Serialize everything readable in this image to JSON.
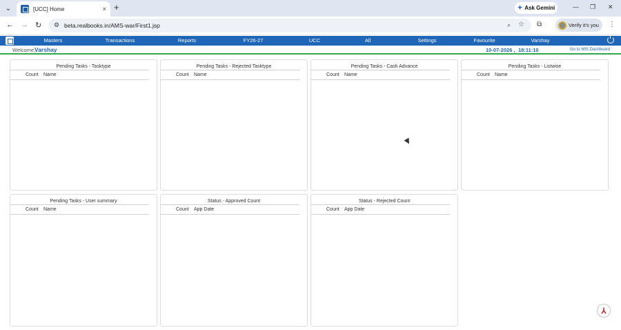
{
  "browser": {
    "tab_title": "[UCC] Home",
    "tab_close": "×",
    "new_tab": "+",
    "ask_gemini": "Ask Gemini",
    "url": "beta.realbooks.in/AMS-war/First1.jsp",
    "verify_label": "Verify it's you",
    "minimize": "—",
    "maximize": "❐",
    "close": "✕"
  },
  "nav_icons": {
    "back": "←",
    "forward": "→",
    "reload": "↻",
    "zoom": "🔍",
    "bookmark": "☆",
    "extensions": "⬚",
    "menu": "⋮",
    "tune": "⚙",
    "tab_search": "⌄"
  },
  "menu": [
    "Masters",
    "Transactions",
    "Reports",
    "FY26-27",
    "UCC",
    "All",
    "Settings",
    "Favourite",
    "Varshay"
  ],
  "welcome": {
    "label": "Welcome,",
    "user": "Varshay",
    "date": "10-07-2026 ,",
    "time": "18:11:10",
    "mis_link": "Go to MIS Dashboard"
  },
  "panels": [
    {
      "title": "Pending Tasks - Tasktype",
      "col1": "Count",
      "col2": "Name"
    },
    {
      "title": "Pending Tasks - Rejected Tasktype",
      "col1": "Count",
      "col2": "Name"
    },
    {
      "title": "Pending Tasks - Cash Advance",
      "col1": "Count",
      "col2": "Name"
    },
    {
      "title": "Pending Tasks - Listwise",
      "col1": "Count",
      "col2": "Name"
    },
    {
      "title": "Pending Tasks - User summary",
      "col1": "Count",
      "col2": "Name"
    },
    {
      "title": "Status - Approved Count",
      "col1": "Count",
      "col2": "App Date"
    },
    {
      "title": "Status - Rejected Count",
      "col1": "Count",
      "col2": "App Date"
    }
  ],
  "colors": {
    "brand_blue": "#1f66b8",
    "accent_green": "#2fa84f",
    "pdf_red": "#c01818"
  },
  "icons": {
    "pdf": "pdf-icon",
    "power": "power-icon",
    "logo": "app-logo-icon"
  }
}
